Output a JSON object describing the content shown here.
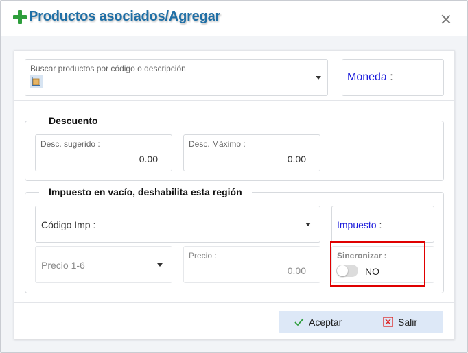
{
  "dialog": {
    "title": "Productos asociados/Agregar"
  },
  "search": {
    "placeholder": "Buscar productos por código o descripción"
  },
  "moneda": {
    "label": "Moneda",
    "colon": ":"
  },
  "descuento": {
    "legend": "Descuento",
    "sugerido_label": "Desc. sugerido :",
    "sugerido_value": "0.00",
    "maximo_label": "Desc. Máximo :",
    "maximo_value": "0.00"
  },
  "impuesto_section": {
    "legend": "Impuesto en vacío, deshabilita esta región",
    "codigo_imp_label": "Código Imp :",
    "impuesto_label": "Impuesto",
    "impuesto_colon": ":",
    "precio_select": "Precio 1-6",
    "precio_label": "Precio :",
    "precio_value": "0.00",
    "sincronizar_label": "Sincronizar :",
    "sincronizar_value": "NO"
  },
  "footer": {
    "accept_label": "Aceptar",
    "exit_label": "Salir"
  },
  "colors": {
    "title": "#1f6fa6",
    "plus": "#2e9e3c",
    "accent_blue": "#1a1adb",
    "highlight_red": "#e00000",
    "footer_bg": "#dde8f7"
  }
}
